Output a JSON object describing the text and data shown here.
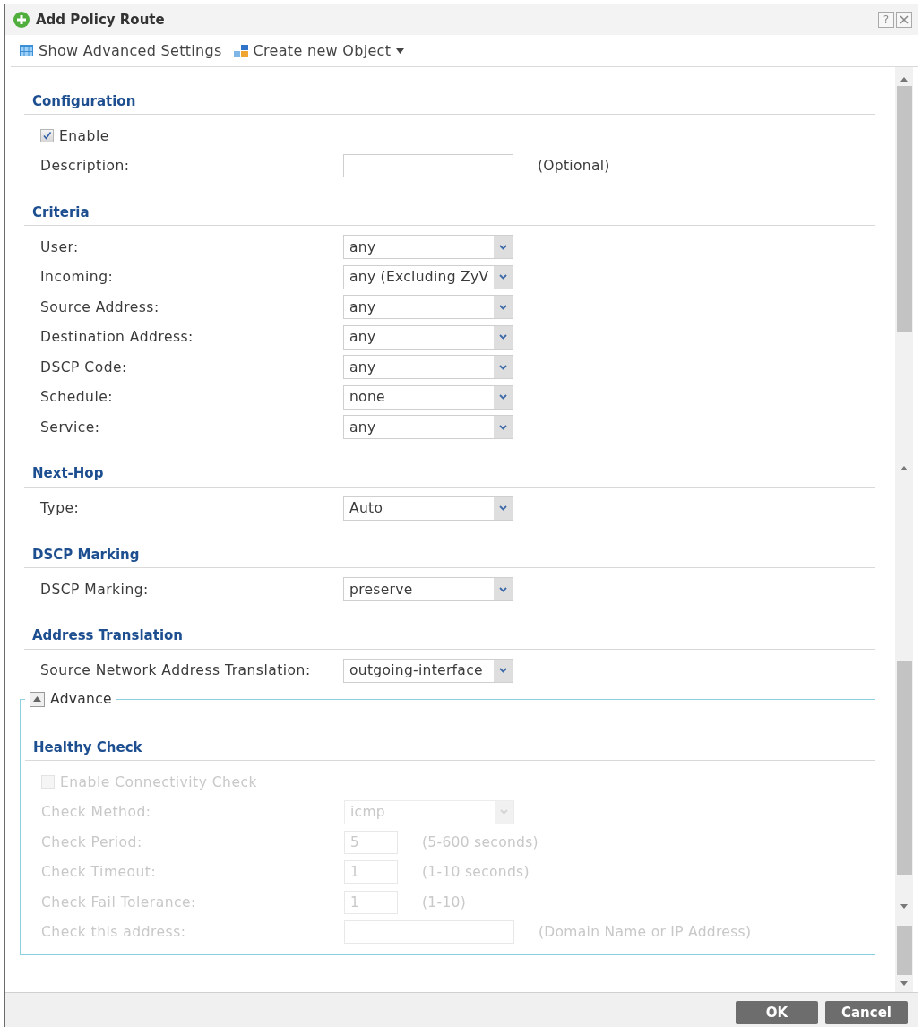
{
  "window": {
    "title": "Add Policy Route",
    "help": "?"
  },
  "toolbar": [
    {
      "kind": "settings",
      "label": "Show Advanced Settings"
    },
    {
      "kind": "menu",
      "label": "Create new Object"
    }
  ],
  "sections": [
    {
      "title": "Configuration",
      "rows": [
        {
          "kind": "checkbox",
          "label": "Enable",
          "checked": true,
          "disabled": false
        },
        {
          "kind": "text",
          "label": "Description:",
          "hint": "(Optional)",
          "disabled": false
        }
      ]
    },
    {
      "title": "Criteria",
      "rows": [
        {
          "kind": "select",
          "label": "User:",
          "value": "any",
          "disabled": false
        },
        {
          "kind": "select",
          "label": "Incoming:",
          "value": "any (Excluding ZyV",
          "disabled": false
        },
        {
          "kind": "select",
          "label": "Source Address:",
          "value": "any",
          "disabled": false
        },
        {
          "kind": "select",
          "label": "Destination Address:",
          "value": "any",
          "disabled": false
        },
        {
          "kind": "select",
          "label": "DSCP Code:",
          "value": "any",
          "disabled": false
        },
        {
          "kind": "select",
          "label": "Schedule:",
          "value": "none",
          "disabled": false
        },
        {
          "kind": "select",
          "label": "Service:",
          "value": "any",
          "disabled": false
        }
      ]
    },
    {
      "title": "Next-Hop",
      "rows": [
        {
          "kind": "select",
          "label": "Type:",
          "value": "Auto",
          "disabled": false
        }
      ]
    },
    {
      "title": "DSCP Marking",
      "rows": [
        {
          "kind": "select",
          "label": "DSCP Marking:",
          "value": "preserve",
          "disabled": false
        }
      ]
    },
    {
      "title": "Address Translation",
      "rows": [
        {
          "kind": "select",
          "label": "Source Network Address Translation:",
          "value": "outgoing-interface",
          "disabled": false
        }
      ]
    }
  ],
  "advance": {
    "label": "Advance",
    "expanded": true,
    "sections": [
      {
        "title": "Healthy Check",
        "rows": [
          {
            "kind": "checkbox",
            "label": "Enable Connectivity Check",
            "checked": false,
            "disabled": true
          },
          {
            "kind": "select",
            "label": "Check Method:",
            "value": "icmp",
            "disabled": true
          },
          {
            "kind": "number",
            "label": "Check Period:",
            "value": "5",
            "hint": "(5-600 seconds)",
            "disabled": true
          },
          {
            "kind": "number",
            "label": "Check Timeout:",
            "value": "1",
            "hint": "(1-10 seconds)",
            "disabled": true
          },
          {
            "kind": "number",
            "label": "Check Fail Tolerance:",
            "value": "1",
            "hint": "(1-10)",
            "disabled": true
          },
          {
            "kind": "text",
            "label": "Check this address:",
            "hint": "(Domain Name or IP Address)",
            "disabled": true
          }
        ]
      }
    ]
  },
  "buttons": [
    "OK",
    "Cancel"
  ]
}
